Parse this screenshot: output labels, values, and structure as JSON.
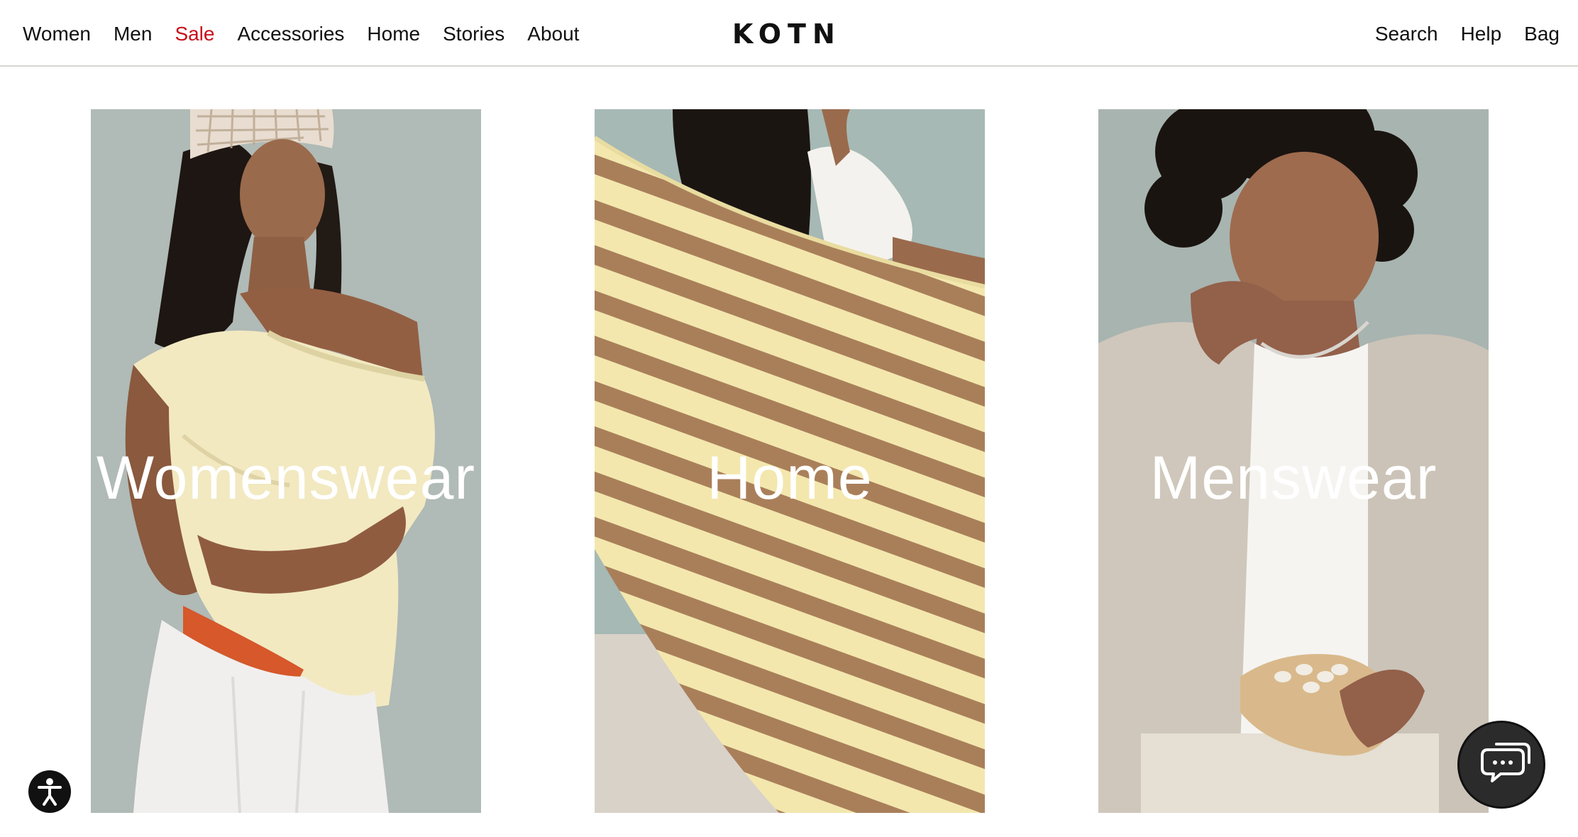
{
  "header": {
    "nav_left": [
      "Women",
      "Men",
      "Sale",
      "Accessories",
      "Home",
      "Stories",
      "About"
    ],
    "logo": "KOTN",
    "nav_right": [
      "Search",
      "Help",
      "Bag"
    ],
    "sale_color": "#c8101c"
  },
  "panels": [
    {
      "label": "Womenswear"
    },
    {
      "label": "Home"
    },
    {
      "label": "Menswear"
    }
  ],
  "widgets": {
    "accessibility_icon": "accessibility-icon",
    "chat_icon": "chat-icon"
  }
}
